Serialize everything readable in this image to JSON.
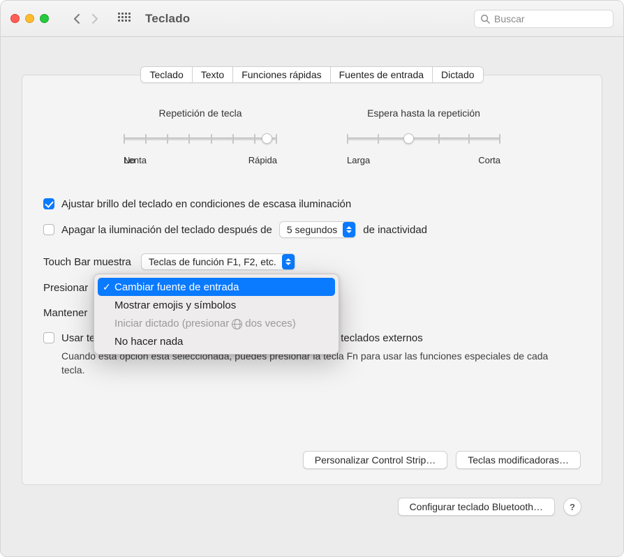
{
  "window": {
    "title": "Teclado"
  },
  "search": {
    "placeholder": "Buscar"
  },
  "tabs": [
    "Teclado",
    "Texto",
    "Funciones rápidas",
    "Fuentes de entrada",
    "Dictado"
  ],
  "active_tab": 0,
  "sliders": {
    "key_repeat": {
      "label": "Repetición de tecla",
      "ticks": 8,
      "position_pct": 93,
      "labels": [
        "No",
        "Lenta",
        "Rápida"
      ]
    },
    "delay": {
      "label": "Espera hasta la repetición",
      "ticks": 6,
      "position_pct": 40,
      "labels": [
        "Larga",
        "Corta"
      ]
    }
  },
  "checks": {
    "auto_brightness": {
      "checked": true,
      "label": "Ajustar brillo del teclado en condiciones de escasa iluminación"
    },
    "turn_off": {
      "checked": false,
      "label_before": "Apagar la iluminación del teclado después de",
      "select_value": "5 segundos",
      "label_after": "de inactividad"
    },
    "use_fn": {
      "checked": false,
      "label": "Usar teclas F1, F2, etc. como teclas de función estándar en teclados externos",
      "help": "Cuando esta opción está seleccionada, puedes presionar la tecla Fn para usar las funciones especiales de cada tecla."
    }
  },
  "touchbar": {
    "label": "Touch Bar muestra",
    "value": "Teclas de función F1, F2, etc."
  },
  "press_label_prefix": "Presionar",
  "hold_label_prefix": "Mantener",
  "menu": {
    "items": [
      {
        "text": "Cambiar fuente de entrada",
        "selected": true
      },
      {
        "text": "Mostrar emojis y símbolos",
        "selected": false
      },
      {
        "text_before": "Iniciar dictado (presionar",
        "text_after": "dos veces)",
        "globe": true,
        "disabled": true
      },
      {
        "text": "No hacer nada",
        "selected": false
      }
    ]
  },
  "buttons": {
    "customize": "Personalizar Control Strip…",
    "modifiers": "Teclas modificadoras…",
    "bluetooth": "Configurar teclado Bluetooth…"
  }
}
